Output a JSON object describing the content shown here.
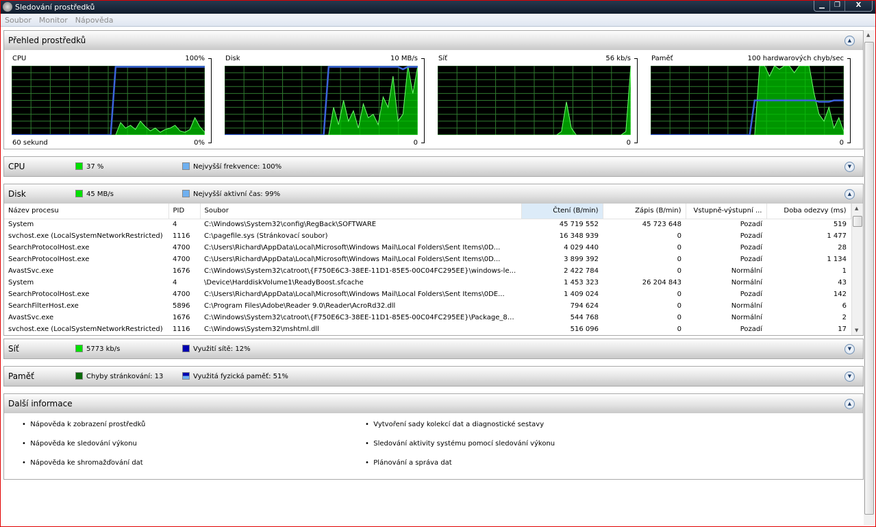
{
  "window": {
    "title": "Sledování prostředků",
    "min": "▁",
    "max": "❐",
    "close": "X"
  },
  "menu": [
    "Soubor",
    "Monitor",
    "Nápověda"
  ],
  "overview": {
    "title": "Přehled prostředků",
    "graphs": [
      {
        "label": "CPU",
        "scale": "100%",
        "bottom_left": "60 sekund",
        "bottom_right": "0%"
      },
      {
        "label": "Disk",
        "scale": "10 MB/s",
        "bottom_left": "",
        "bottom_right": "0"
      },
      {
        "label": "Síť",
        "scale": "56 kb/s",
        "bottom_left": "",
        "bottom_right": "0"
      },
      {
        "label": "Paměť",
        "scale": "100 hardwarových chyb/sec",
        "bottom_left": "",
        "bottom_right": "0"
      }
    ]
  },
  "chart_data": [
    {
      "type": "area",
      "title": "CPU",
      "ylim": [
        0,
        100
      ],
      "green": [
        0,
        0,
        0,
        0,
        0,
        0,
        0,
        0,
        0,
        0,
        0,
        0,
        0,
        0,
        0,
        0,
        0,
        0,
        0,
        0,
        0,
        0,
        18,
        10,
        14,
        8,
        20,
        12,
        6,
        10,
        4,
        8,
        10,
        14,
        6,
        4,
        8,
        25,
        12,
        4
      ],
      "blue": [
        0,
        0,
        0,
        0,
        0,
        0,
        0,
        0,
        0,
        0,
        0,
        0,
        0,
        0,
        0,
        0,
        0,
        0,
        0,
        0,
        0,
        100,
        100,
        100,
        100,
        100,
        100,
        100,
        100,
        100,
        100,
        100,
        100,
        100,
        100,
        100,
        100,
        100,
        100,
        100
      ]
    },
    {
      "type": "area",
      "title": "Disk",
      "ylim": [
        0,
        100
      ],
      "green": [
        0,
        0,
        0,
        0,
        0,
        0,
        0,
        0,
        0,
        0,
        0,
        0,
        0,
        0,
        0,
        0,
        0,
        0,
        0,
        0,
        0,
        0,
        40,
        15,
        50,
        20,
        35,
        10,
        45,
        25,
        30,
        15,
        55,
        40,
        85,
        20,
        30,
        100,
        60,
        100
      ],
      "blue": [
        0,
        0,
        0,
        0,
        0,
        0,
        0,
        0,
        0,
        0,
        0,
        0,
        0,
        0,
        0,
        0,
        0,
        0,
        0,
        0,
        0,
        100,
        100,
        100,
        100,
        100,
        100,
        100,
        100,
        100,
        100,
        100,
        100,
        100,
        100,
        100,
        95,
        100,
        100,
        100
      ]
    },
    {
      "type": "area",
      "title": "Síť",
      "ylim": [
        0,
        100
      ],
      "green": [
        0,
        0,
        0,
        0,
        0,
        0,
        0,
        0,
        0,
        0,
        0,
        0,
        0,
        0,
        0,
        0,
        0,
        0,
        0,
        0,
        0,
        0,
        0,
        0,
        0,
        5,
        48,
        10,
        0,
        0,
        0,
        0,
        0,
        0,
        0,
        0,
        0,
        0,
        5,
        100
      ],
      "blue": []
    },
    {
      "type": "area",
      "title": "Paměť",
      "ylim": [
        0,
        100
      ],
      "green": [
        0,
        0,
        0,
        0,
        0,
        0,
        0,
        0,
        0,
        0,
        0,
        0,
        0,
        0,
        0,
        0,
        0,
        0,
        0,
        0,
        0,
        0,
        100,
        100,
        85,
        100,
        95,
        100,
        100,
        90,
        100,
        100,
        100,
        60,
        30,
        20,
        40,
        10,
        25,
        5
      ],
      "blue": [
        0,
        0,
        0,
        0,
        0,
        0,
        0,
        0,
        0,
        0,
        0,
        0,
        0,
        0,
        0,
        0,
        0,
        0,
        0,
        0,
        0,
        50,
        50,
        50,
        50,
        50,
        50,
        50,
        50,
        50,
        50,
        50,
        50,
        50,
        48,
        48,
        48,
        50,
        50,
        50
      ]
    }
  ],
  "cpu": {
    "title": "CPU",
    "usage": "37 %",
    "max_freq": "Nejvyšší frekvence: 100%"
  },
  "disk": {
    "title": "Disk",
    "usage": "45 MB/s",
    "active": "Nejvyšší aktivní čas: 99%",
    "columns": [
      "Název procesu",
      "PID",
      "Soubor",
      "Čtení (B/min)",
      "Zápis (B/min)",
      "Vstupně-výstupní ...",
      "Doba odezvy (ms)"
    ],
    "rows": [
      [
        "System",
        "4",
        "C:\\Windows\\System32\\config\\RegBack\\SOFTWARE",
        "45 719 552",
        "45 723 648",
        "Pozadí",
        "519"
      ],
      [
        "svchost.exe (LocalSystemNetworkRestricted)",
        "1116",
        "C:\\pagefile.sys (Stránkovací soubor)",
        "16 348 939",
        "0",
        "Pozadí",
        "1 477"
      ],
      [
        "SearchProtocolHost.exe",
        "4700",
        "C:\\Users\\Richard\\AppData\\Local\\Microsoft\\Windows Mail\\Local Folders\\Sent Items\\0D...",
        "4 029 440",
        "0",
        "Pozadí",
        "28"
      ],
      [
        "SearchProtocolHost.exe",
        "4700",
        "C:\\Users\\Richard\\AppData\\Local\\Microsoft\\Windows Mail\\Local Folders\\Sent Items\\0D...",
        "3 899 392",
        "0",
        "Pozadí",
        "1 134"
      ],
      [
        "AvastSvc.exe",
        "1676",
        "C:\\Windows\\System32\\catroot\\{F750E6C3-38EE-11D1-85E5-00C04FC295EE}\\windows-le...",
        "2 422 784",
        "0",
        "Normální",
        "1"
      ],
      [
        "System",
        "4",
        "\\Device\\HarddiskVolume1\\ReadyBoost.sfcache",
        "1 453 323",
        "26 204 843",
        "Normální",
        "43"
      ],
      [
        "SearchProtocolHost.exe",
        "4700",
        "C:\\Users\\Richard\\AppData\\Local\\Microsoft\\Windows Mail\\Local Folders\\Sent Items\\0DE...",
        "1 409 024",
        "0",
        "Pozadí",
        "142"
      ],
      [
        "SearchFilterHost.exe",
        "5896",
        "C:\\Program Files\\Adobe\\Reader 9.0\\Reader\\AcroRd32.dll",
        "794 624",
        "0",
        "Normální",
        "6"
      ],
      [
        "AvastSvc.exe",
        "1676",
        "C:\\Windows\\System32\\catroot\\{F750E6C3-38EE-11D1-85E5-00C04FC295EE}\\Package_8_f...",
        "544 768",
        "0",
        "Normální",
        "2"
      ],
      [
        "svchost.exe (LocalSystemNetworkRestricted)",
        "1116",
        "C:\\Windows\\System32\\mshtml.dll",
        "516 096",
        "0",
        "Pozadí",
        "17"
      ]
    ]
  },
  "net": {
    "title": "Síť",
    "usage": "5773 kb/s",
    "util": "Využití sítě: 12%"
  },
  "mem": {
    "title": "Paměť",
    "faults": "Chyby stránkování: 13",
    "phys": "Využitá fyzická paměť: 51%"
  },
  "more": {
    "title": "Další informace",
    "links": [
      "Nápověda k zobrazení prostředků",
      "Nápověda ke sledování výkonu",
      "Nápověda ke shromažďování dat",
      "Vytvoření sady kolekcí dat a diagnostické sestavy",
      "Sledování aktivity systému pomocí sledování výkonu",
      "Plánování a správa dat"
    ]
  },
  "colors": {
    "graph_green": "#00c800",
    "graph_line": "#3c8c3c",
    "graph_blue": "#3c64dc",
    "swatch_green": "#00e000",
    "swatch_blue": "#6fb0f0",
    "swatch_navy": "#0000b0"
  }
}
